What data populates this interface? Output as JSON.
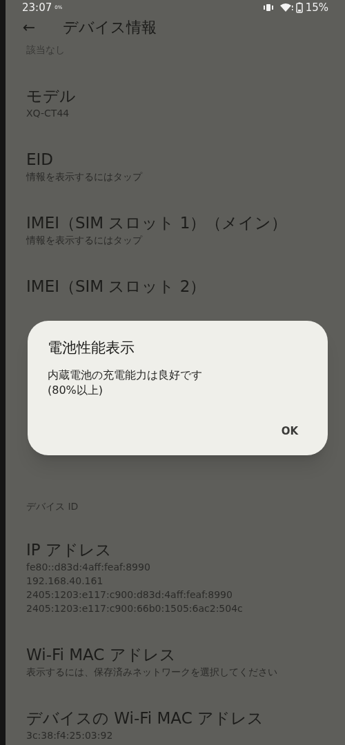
{
  "status_bar": {
    "time": "23:07",
    "data_usage": "0%",
    "battery": "15%"
  },
  "app_bar": {
    "back": "←",
    "title": "デバイス情報"
  },
  "partial_text": "該当なし",
  "items": [
    {
      "kind": "entry",
      "title": "モデル",
      "lines": [
        "XQ-CT44"
      ]
    },
    {
      "kind": "entry",
      "title": "EID",
      "lines": [
        "情報を表示するにはタップ"
      ]
    },
    {
      "kind": "entry",
      "title": "IMEI（SIM スロット 1）（メイン）",
      "lines": [
        "情報を表示するにはタップ"
      ]
    },
    {
      "kind": "entry",
      "title": "IMEI（SIM スロット 2）"
    },
    {
      "kind": "covered"
    },
    {
      "kind": "header",
      "title": "デバイス ID"
    },
    {
      "kind": "entry",
      "title": "IP アドレス",
      "lines": [
        "fe80::d83d:4aff:feaf:8990",
        "192.168.40.161",
        "2405:1203:e117:c900:d83d:4aff:feaf:8990",
        "2405:1203:e117:c900:66b0:1505:6ac2:504c"
      ]
    },
    {
      "kind": "entry",
      "title": "Wi-Fi MAC アドレス",
      "lines": [
        "表示するには、保存済みネットワークを選択してください"
      ]
    },
    {
      "kind": "entry",
      "title": "デバイスの Wi-Fi MAC アドレス",
      "lines": [
        "3c:38:f4:25:03:92"
      ]
    }
  ],
  "dialog": {
    "title": "電池性能表示",
    "message": [
      "内蔵電池の充電能力は良好です",
      "(80%以上)"
    ],
    "button": "OK"
  }
}
